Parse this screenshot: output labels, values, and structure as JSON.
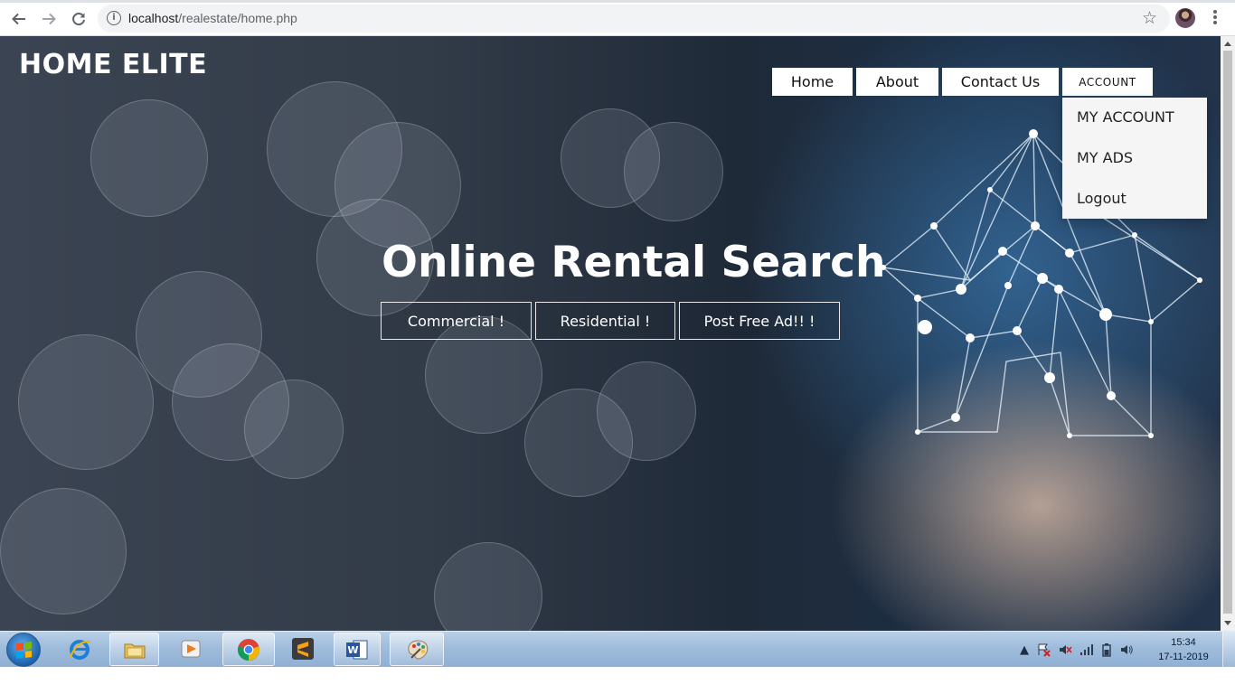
{
  "browser": {
    "url_host": "localhost",
    "url_path": "/realestate/home.php"
  },
  "site": {
    "brand": "HOME ELITE",
    "nav": {
      "home": "Home",
      "about": "About",
      "contact": "Contact Us",
      "account": "ACCOUNT"
    },
    "account_menu": {
      "my_account": "MY ACCOUNT",
      "my_ads": "MY ADS",
      "logout": "Logout"
    },
    "headline": "Online Rental Search",
    "cta": {
      "commercial": "Commercial !",
      "residential": "Residential !",
      "post_ad": "Post Free Ad!! !"
    }
  },
  "taskbar": {
    "apps": [
      "start-orb",
      "internet-explorer",
      "file-explorer",
      "media-player",
      "chrome",
      "sublime-text",
      "word",
      "paint"
    ],
    "clock_time": "15:34",
    "clock_date": "17-11-2019"
  }
}
